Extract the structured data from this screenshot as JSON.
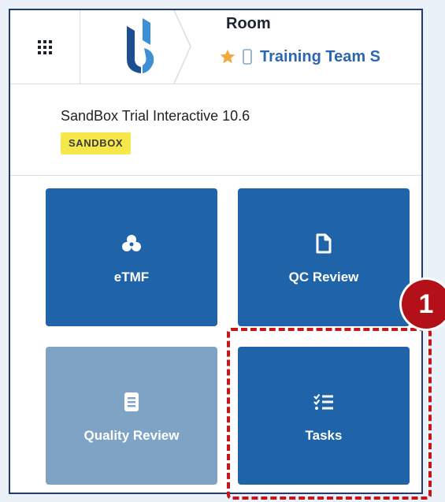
{
  "header": {
    "apps_icon": "grid-icon",
    "logo_icon": "brand-logo",
    "breadcrumb_label": "Room",
    "favorite_icon": "star-icon",
    "device_icon": "mobile-icon",
    "room_name": "Training Team S"
  },
  "study": {
    "name": "SandBox Trial Interactive 10.6",
    "badge": "SANDBOX"
  },
  "tiles": [
    {
      "label": "eTMF",
      "icon": "cluster-icon",
      "enabled": true
    },
    {
      "label": "QC Review",
      "icon": "document-icon",
      "enabled": true
    },
    {
      "label": "Quality Review",
      "icon": "notebook-icon",
      "enabled": false
    },
    {
      "label": "Tasks",
      "icon": "checklist-icon",
      "enabled": true
    }
  ],
  "annotation": {
    "step_number": "1",
    "highlight_color": "#c4161c"
  },
  "colors": {
    "tile_blue": "#1f63a8",
    "tile_disabled": "#7fa3c4",
    "link_blue": "#2b66b0",
    "badge_yellow": "#f6e84a"
  }
}
